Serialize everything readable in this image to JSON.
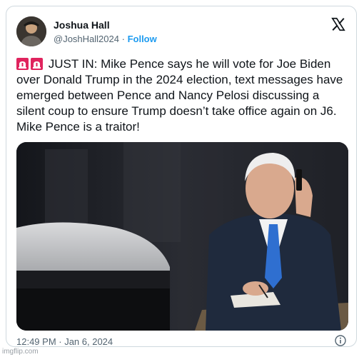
{
  "tweet": {
    "author_name": "Joshua Hall",
    "handle": "@JoshHall2024",
    "separator": "·",
    "follow_label": "Follow",
    "text": "JUST IN: Mike Pence says he will vote for Joe Biden over Donald Trump in the 2024 election, text messages have emerged between Pence and Nancy Pelosi discussing a silent coup to ensure Trump doesn’t take office again on J6. Mike Pence is a traitor!",
    "emoji_icons": [
      "rotating-light-icon",
      "rotating-light-icon"
    ],
    "timestamp": "12:49 PM · Jan 6, 2024"
  },
  "icons": {
    "logo": "x-logo-icon",
    "info": "info-icon"
  },
  "colors": {
    "follow": "#1d9bf0",
    "text": "#0f1419",
    "secondary": "#536471",
    "border": "#cfd9de",
    "siren": "#e0245e"
  },
  "watermark": "imgflip.com"
}
